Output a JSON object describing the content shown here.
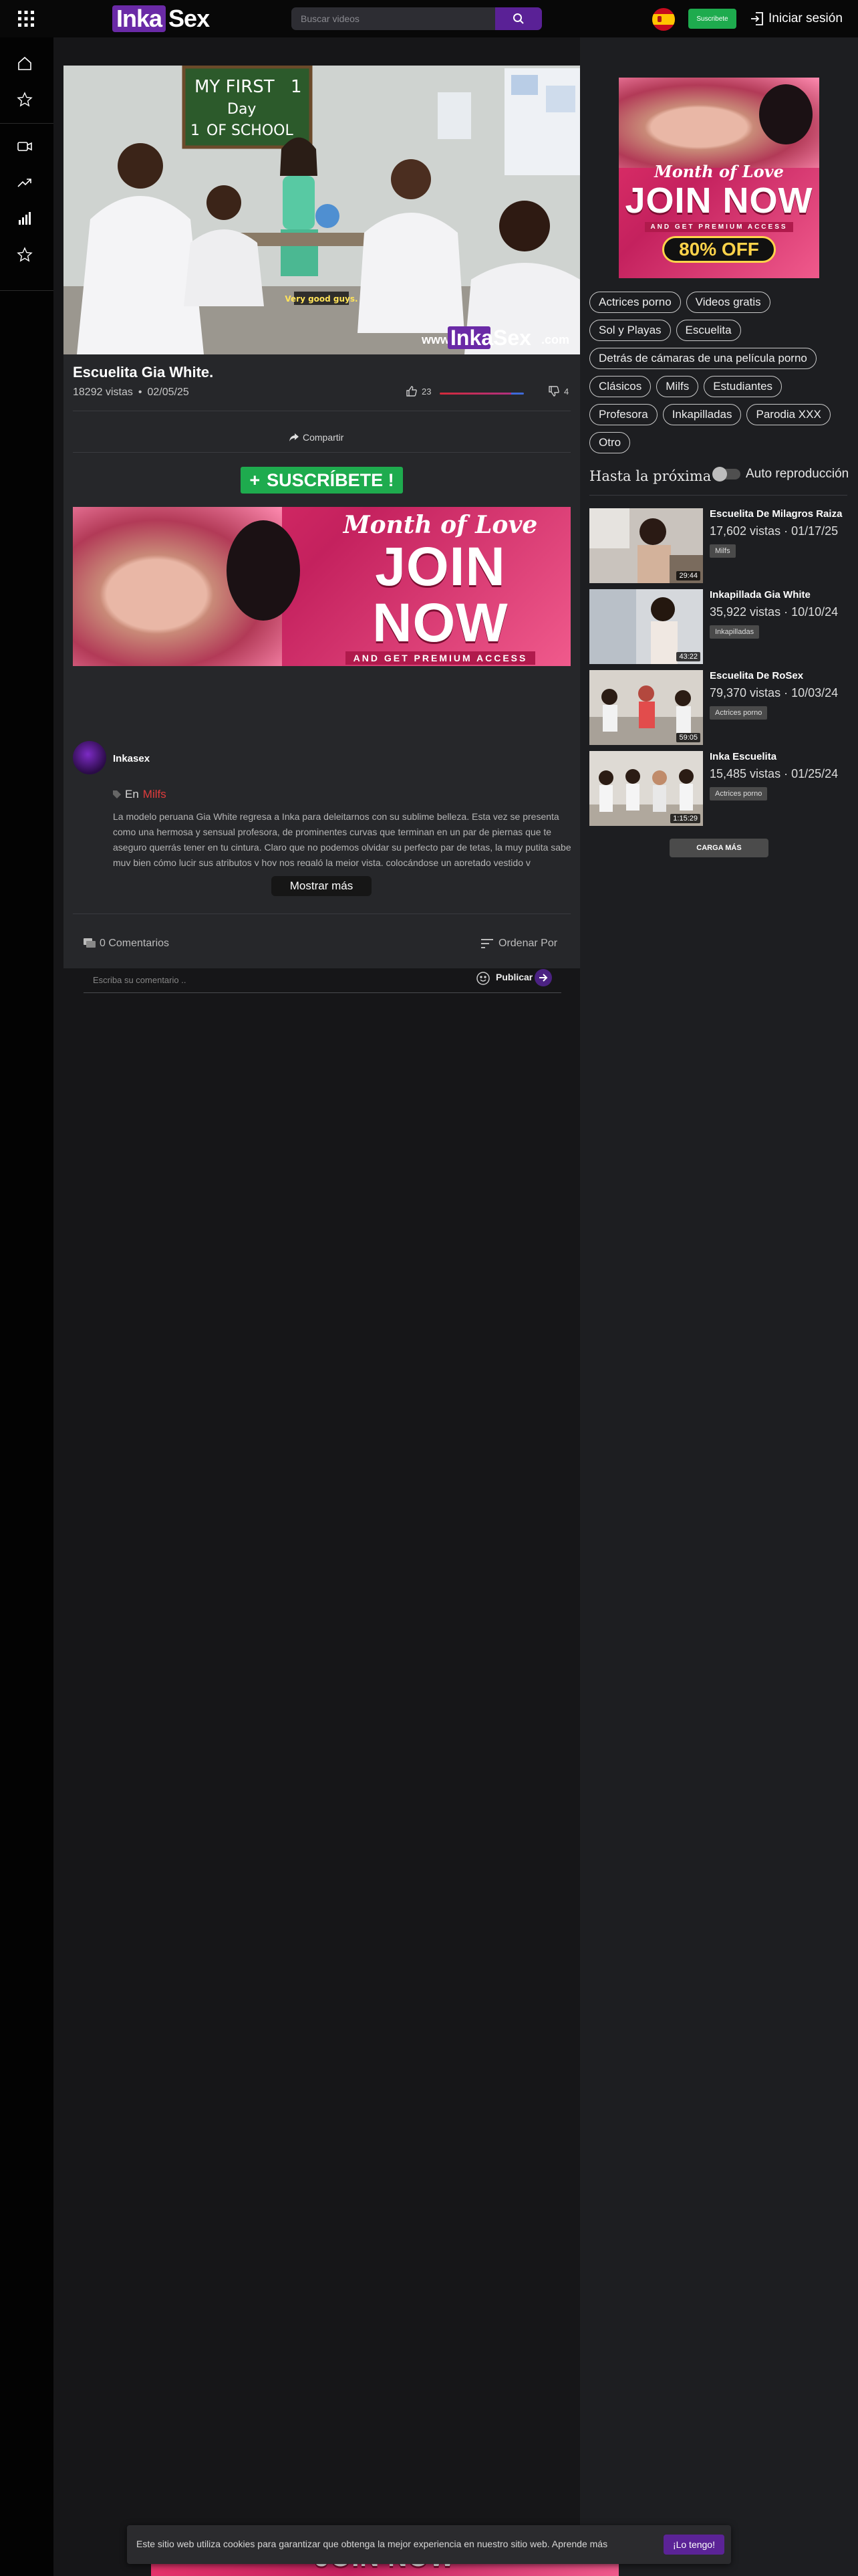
{
  "header": {
    "logo_part1": "Inka",
    "logo_part2": "Sex",
    "search_placeholder": "Buscar videos",
    "language_flag": "es",
    "subscribe_label": "Suscribete",
    "login_label": "Iniciar sesión"
  },
  "sidebar": {
    "items": [
      "home-icon",
      "star-icon",
      "video-camera-icon",
      "trending-icon",
      "bar-chart-icon",
      "star-icon"
    ]
  },
  "video": {
    "watermark_prefix": "www.",
    "watermark_brand_1": "Inka",
    "watermark_brand_2": "Sex",
    "watermark_suffix": ".com",
    "board_line1": "MY FIRST",
    "board_line2": "1",
    "board_line3": "Day",
    "board_line4": "1",
    "board_line5": "OF SCHOOL",
    "caption": "Very good guys.",
    "title": "Escuelita Gia White.",
    "views": "18292 vistas",
    "date": "02/05/25",
    "likes": "23",
    "dislikes": "4",
    "like_ratio": 0.85
  },
  "share_label": "Compartir",
  "subscribe_big": {
    "plus": "+",
    "label": "SUSCRÍBETE !"
  },
  "ad": {
    "script": "Month of Love",
    "headline": "JOIN NOW",
    "sub": "AND GET PREMIUM ACCESS",
    "offer": "80% OFF"
  },
  "channel": {
    "name": "Inkasex"
  },
  "category": {
    "prefix": "En",
    "name": "Milfs"
  },
  "description": "La modelo peruana Gia White regresa a Inka para deleitarnos con su sublime belleza. Esta vez se presenta como una hermosa y sensual profesora, de prominentes curvas que terminan en un par de piernas que te aseguro querrás tener en tu cintura. Claro que no podemos olvidar su perfecto par de tetas, la muy putita sabe muy bien cómo lucir sus atributos y hoy nos regaló la mejor vista, colocándose un apretado vestido v",
  "show_more_label": "Mostrar más",
  "comments": {
    "count_label": "0 Comentarios",
    "order_label": "Ordenar Por",
    "input_placeholder": "Escriba su comentario ..",
    "publish_label": "Publicar"
  },
  "tags": [
    "Actrices porno",
    "Videos gratis",
    "Sol y Playas",
    "Escuelita",
    "Detrás de cámaras de una película porno",
    "Clásicos",
    "Milfs",
    "Estudiantes",
    "Profesora",
    "Inkapilladas",
    "Parodia XXX",
    "Otro"
  ],
  "up_next": {
    "title": "Hasta la próxima",
    "autoplay_label": "Auto reproducción",
    "autoplay_on": false
  },
  "related": [
    {
      "title": "Escuelita De Milagros Raiza",
      "meta": "17,602 vistas · 01/17/25",
      "badge": "Milfs",
      "duration": "29:44"
    },
    {
      "title": "Inkapillada Gia White",
      "meta": "35,922 vistas · 10/10/24",
      "badge": "Inkapilladas",
      "duration": "43:22"
    },
    {
      "title": "Escuelita De RoSex",
      "meta": "79,370 vistas · 10/03/24",
      "badge": "Actrices porno",
      "duration": "59:05"
    },
    {
      "title": "Inka Escuelita",
      "meta": "15,485 vistas · 01/25/24",
      "badge": "Actrices porno",
      "duration": "1:15:29"
    }
  ],
  "load_more_label": "CARGA MÁS",
  "cookie": {
    "text": "Este sitio web utiliza cookies para garantizar que obtenga la mejor experiencia en nuestro sitio web. Aprende más",
    "button": "¡Lo tengo!"
  },
  "colors": {
    "accent": "#5a2196",
    "green": "#1eab4e",
    "category_link": "#e03c3c",
    "ad_pink": "#e9356c"
  }
}
